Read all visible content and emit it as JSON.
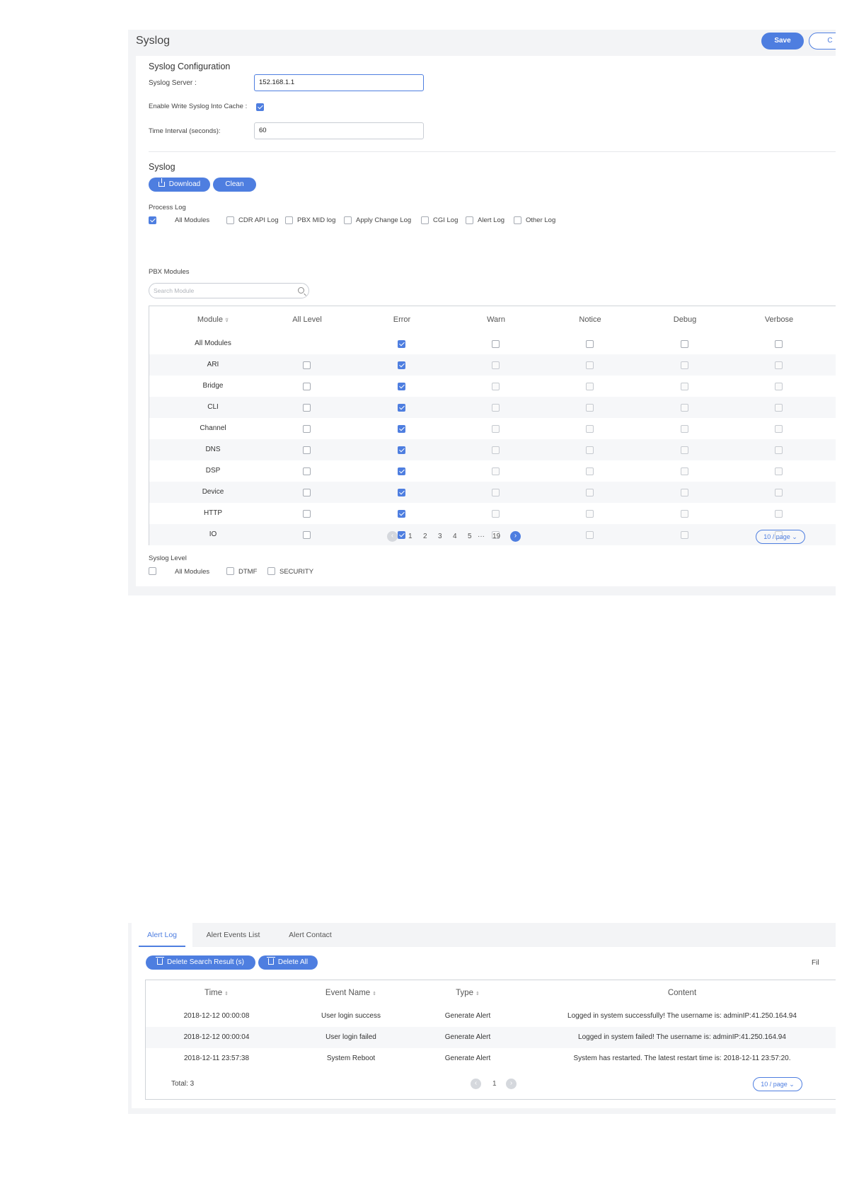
{
  "syslog_page": {
    "title": "Syslog",
    "save_label": "Save",
    "cancel_label": "C",
    "config": {
      "section_title": "Syslog Configuration",
      "server_label": "Syslog Server :",
      "server_value": "152.168.1.1",
      "cache_label": "Enable Write Syslog Into Cache :",
      "cache_checked": true,
      "interval_label": "Time Interval (seconds):",
      "interval_value": "60"
    },
    "syslog_section": {
      "title": "Syslog",
      "download_label": "Download",
      "clean_label": "Clean"
    },
    "process_log": {
      "label": "Process Log",
      "options": [
        {
          "label": "All Modules",
          "checked": true
        },
        {
          "label": "CDR API Log",
          "checked": false
        },
        {
          "label": "PBX MID log",
          "checked": false
        },
        {
          "label": "Apply Change Log",
          "checked": false
        },
        {
          "label": "CGI Log",
          "checked": false
        },
        {
          "label": "Alert Log",
          "checked": false
        },
        {
          "label": "Other Log",
          "checked": false
        }
      ]
    },
    "pbx_modules": {
      "label": "PBX Modules",
      "search_placeholder": "Search Module",
      "columns": [
        "Module",
        "All Level",
        "Error",
        "Warn",
        "Notice",
        "Debug",
        "Verbose"
      ],
      "rows": [
        {
          "module": "All Modules",
          "all_level": null,
          "error": true,
          "warn": false,
          "notice": false,
          "debug": false,
          "verbose": false
        },
        {
          "module": "ARI",
          "all_level": false,
          "error": true,
          "warn": false,
          "notice": false,
          "debug": false,
          "verbose": false
        },
        {
          "module": "Bridge",
          "all_level": false,
          "error": true,
          "warn": false,
          "notice": false,
          "debug": false,
          "verbose": false
        },
        {
          "module": "CLI",
          "all_level": false,
          "error": true,
          "warn": false,
          "notice": false,
          "debug": false,
          "verbose": false
        },
        {
          "module": "Channel",
          "all_level": false,
          "error": true,
          "warn": false,
          "notice": false,
          "debug": false,
          "verbose": false
        },
        {
          "module": "DNS",
          "all_level": false,
          "error": true,
          "warn": false,
          "notice": false,
          "debug": false,
          "verbose": false
        },
        {
          "module": "DSP",
          "all_level": false,
          "error": true,
          "warn": false,
          "notice": false,
          "debug": false,
          "verbose": false
        },
        {
          "module": "Device",
          "all_level": false,
          "error": true,
          "warn": false,
          "notice": false,
          "debug": false,
          "verbose": false
        },
        {
          "module": "HTTP",
          "all_level": false,
          "error": true,
          "warn": false,
          "notice": false,
          "debug": false,
          "verbose": false
        },
        {
          "module": "IO",
          "all_level": false,
          "error": true,
          "warn": false,
          "notice": false,
          "debug": false,
          "verbose": false
        }
      ],
      "pagination": {
        "prev": "‹",
        "pages": [
          "1",
          "2",
          "3",
          "4",
          "5"
        ],
        "ellipsis": "···",
        "last": "19",
        "next": "›",
        "page_size": "10 / page"
      }
    },
    "syslog_level": {
      "label": "Syslog Level",
      "options": [
        {
          "label": "All Modules",
          "checked": false
        },
        {
          "label": "DTMF",
          "checked": false
        },
        {
          "label": "SECURITY",
          "checked": false
        }
      ]
    }
  },
  "alert_page": {
    "tabs": [
      "Alert Log",
      "Alert Events List",
      "Alert Contact"
    ],
    "active_tab": 0,
    "delete_search_label": "Delete Search Result (s)",
    "delete_all_label": "Delete All",
    "filter_label": "Fil",
    "columns": [
      "Time",
      "Event Name",
      "Type",
      "Content"
    ],
    "rows": [
      {
        "time": "2018-12-12 00:00:08",
        "event": "User login success",
        "type": "Generate Alert",
        "content": "Logged in system successfully! The username is: adminIP:41.250.164.94"
      },
      {
        "time": "2018-12-12 00:00:04",
        "event": "User login failed",
        "type": "Generate Alert",
        "content": "Logged in system failed! The username is: adminIP:41.250.164.94"
      },
      {
        "time": "2018-12-11 23:57:38",
        "event": "System Reboot",
        "type": "Generate Alert",
        "content": "System has restarted. The latest restart time is: 2018-12-11 23:57:20."
      }
    ],
    "total_label": "Total: 3",
    "pagination": {
      "prev": "‹",
      "page": "1",
      "next": "›",
      "page_size": "10 / page"
    }
  },
  "colors": {
    "accent": "#4e7ee0",
    "panel_bg": "#f3f4f6",
    "border": "#cfd3d8"
  }
}
